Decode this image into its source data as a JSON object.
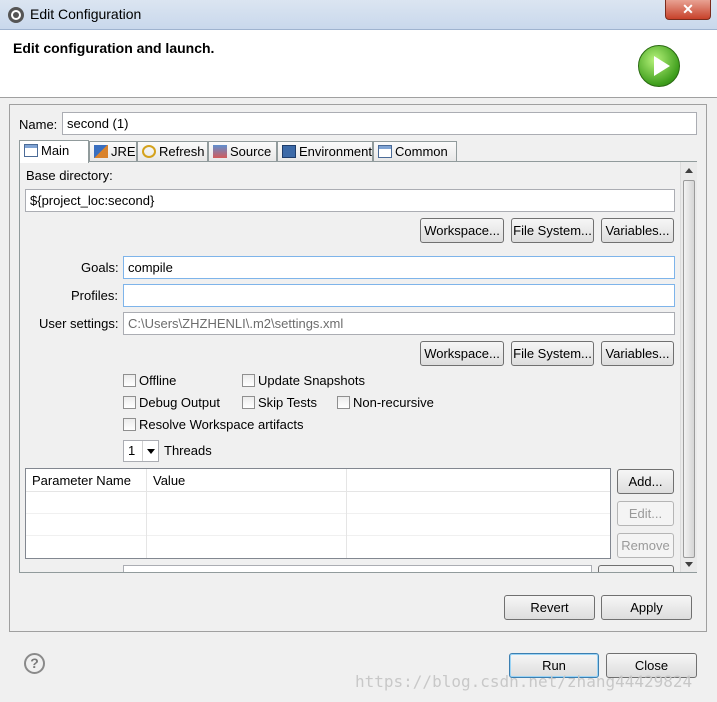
{
  "window": {
    "title": "Edit Configuration",
    "close_glyph": "✕"
  },
  "header": {
    "heading": "Edit configuration and launch.",
    "icon": "run-launch-icon"
  },
  "name": {
    "label": "Name:",
    "value": "second (1)"
  },
  "tabs": [
    {
      "label": "Main",
      "icon": "main-tab-icon",
      "active": true
    },
    {
      "label": "JRE",
      "icon": "jre-icon"
    },
    {
      "label": "Refresh",
      "icon": "refresh-icon"
    },
    {
      "label": "Source",
      "icon": "source-icon"
    },
    {
      "label": "Environment",
      "icon": "environment-icon"
    },
    {
      "label": "Common",
      "icon": "common-icon"
    }
  ],
  "main": {
    "base_dir": {
      "label": "Base directory:",
      "value": "${project_loc:second}"
    },
    "base_buttons": {
      "workspace": "Workspace...",
      "filesystem": "File System...",
      "variables": "Variables..."
    },
    "goals": {
      "label": "Goals:",
      "value": "compile"
    },
    "profiles": {
      "label": "Profiles:",
      "value": ""
    },
    "user_settings": {
      "label": "User settings:",
      "value": "C:\\Users\\ZHZHENLI\\.m2\\settings.xml"
    },
    "settings_buttons": {
      "workspace": "Workspace...",
      "filesystem": "File System...",
      "variables": "Variables..."
    },
    "options": {
      "offline": "Offline",
      "update_snapshots": "Update Snapshots",
      "debug_output": "Debug Output",
      "skip_tests": "Skip Tests",
      "non_recursive": "Non-recursive",
      "resolve_workspace": "Resolve Workspace artifacts"
    },
    "threads": {
      "value": "1",
      "label": "Threads"
    },
    "params_table": {
      "columns": [
        "Parameter Name",
        "Value"
      ],
      "rows": []
    },
    "param_buttons": {
      "add": "Add...",
      "edit": "Edit...",
      "remove": "Remove"
    }
  },
  "footer": {
    "revert": "Revert",
    "apply": "Apply",
    "run": "Run",
    "close": "Close",
    "help": "?"
  },
  "watermark": "https://blog.csdn.net/zhang44429824"
}
